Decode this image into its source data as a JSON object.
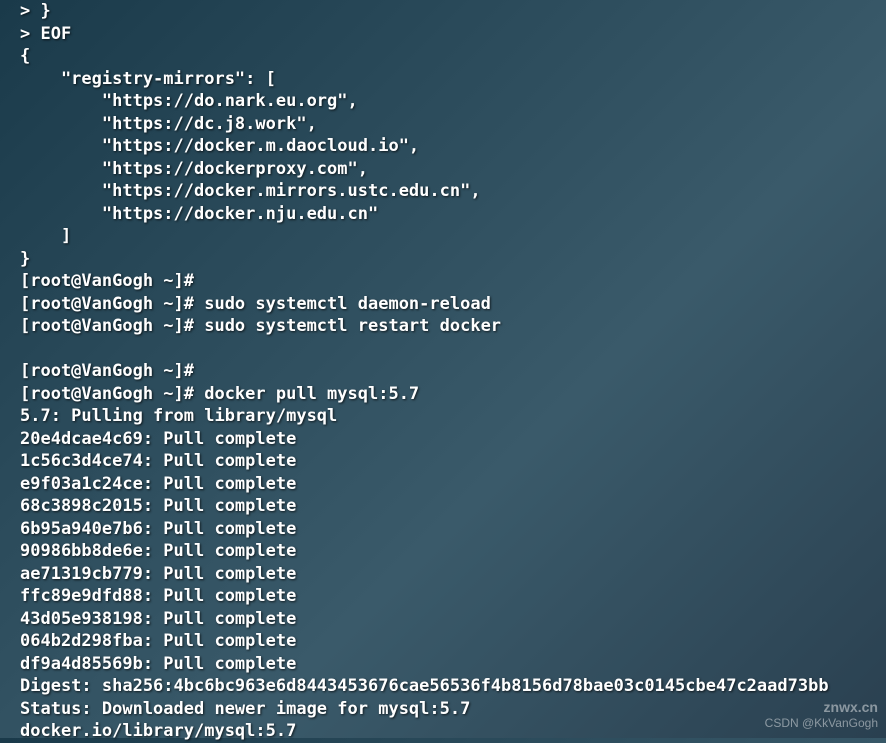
{
  "terminal": {
    "lines": [
      "> }",
      "> EOF",
      "{",
      "    \"registry-mirrors\": [",
      "        \"https://do.nark.eu.org\",",
      "        \"https://dc.j8.work\",",
      "        \"https://docker.m.daocloud.io\",",
      "        \"https://dockerproxy.com\",",
      "        \"https://docker.mirrors.ustc.edu.cn\",",
      "        \"https://docker.nju.edu.cn\"",
      "    ]",
      "}",
      "[root@VanGogh ~]# ",
      "[root@VanGogh ~]# sudo systemctl daemon-reload",
      "[root@VanGogh ~]# sudo systemctl restart docker",
      "",
      "[root@VanGogh ~]# ",
      "[root@VanGogh ~]# docker pull mysql:5.7",
      "5.7: Pulling from library/mysql",
      "20e4dcae4c69: Pull complete ",
      "1c56c3d4ce74: Pull complete ",
      "e9f03a1c24ce: Pull complete ",
      "68c3898c2015: Pull complete ",
      "6b95a940e7b6: Pull complete ",
      "90986bb8de6e: Pull complete ",
      "ae71319cb779: Pull complete ",
      "ffc89e9dfd88: Pull complete ",
      "43d05e938198: Pull complete ",
      "064b2d298fba: Pull complete ",
      "df9a4d85569b: Pull complete ",
      "Digest: sha256:4bc6bc963e6d8443453676cae56536f4b8156d78bae03c0145cbe47c2aad73bb",
      "Status: Downloaded newer image for mysql:5.7",
      "docker.io/library/mysql:5.7"
    ]
  },
  "watermark": {
    "site": "znwx.cn",
    "author": "CSDN @KkVanGogh"
  }
}
